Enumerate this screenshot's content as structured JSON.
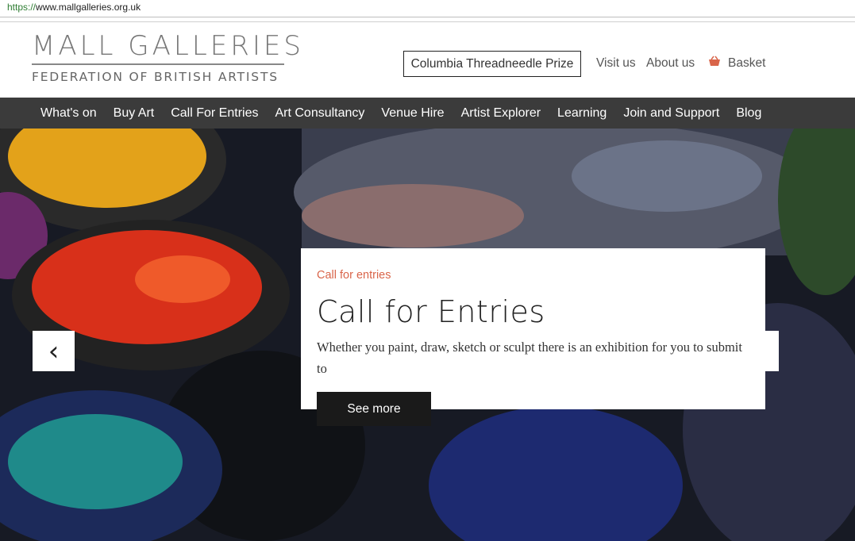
{
  "browser": {
    "url_proto": "https://",
    "url_host": "www.mallgalleries.org.uk"
  },
  "logo": {
    "title": "MALL GALLERIES",
    "subtitle": "FEDERATION OF BRITISH ARTISTS"
  },
  "header": {
    "prize_button": "Columbia Threadneedle Prize",
    "visit_us": "Visit us",
    "about_us": "About us",
    "basket": "Basket",
    "basket_color": "#d9654a"
  },
  "nav": {
    "items": [
      "What's on",
      "Buy Art",
      "Call For Entries",
      "Art Consultancy",
      "Venue Hire",
      "Artist Explorer",
      "Learning",
      "Join and Support",
      "Blog"
    ]
  },
  "hero": {
    "kicker": "Call for entries",
    "title": "Call for Entries",
    "text": "Whether you paint, draw, sketch or sculpt there is an exhibition for you to submit to",
    "button": "See more",
    "prev_icon": "‹",
    "next_icon": "›",
    "accent_color": "#d9654a"
  }
}
